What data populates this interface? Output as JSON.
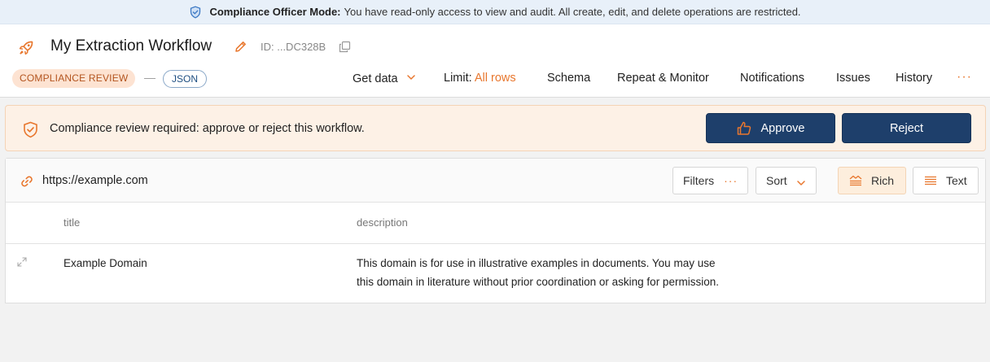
{
  "banner": {
    "mode_label": "Compliance Officer Mode:",
    "message": "You have read-only access to view and audit. All create, edit, and delete operations are restricted."
  },
  "workflow": {
    "title": "My Extraction Workflow",
    "id": "ID: ...DC328B",
    "status_badge": "COMPLIANCE REVIEW",
    "separator": "—",
    "format_badge": "JSON"
  },
  "nav": {
    "get_data": "Get data",
    "limit_label": "Limit:",
    "limit_value": "All rows",
    "schema": "Schema",
    "repeat_monitor": "Repeat & Monitor",
    "notifications": "Notifications",
    "issues": "Issues",
    "history": "History",
    "more": "···"
  },
  "review": {
    "message": "Compliance review required: approve or reject this workflow.",
    "approve_label": "Approve",
    "reject_label": "Reject"
  },
  "panel": {
    "url": "https://example.com",
    "filters_label": "Filters",
    "filters_dots": "···",
    "sort_label": "Sort",
    "rich_label": "Rich",
    "text_label": "Text",
    "columns": [
      "title",
      "description"
    ],
    "rows": [
      {
        "title": "Example Domain",
        "description_line1": "This domain is for use in illustrative examples in documents. You may use",
        "description_line2": "this domain in literature without prior coordination or asking for permission."
      }
    ]
  },
  "colors": {
    "accent": "#e8772e",
    "primary_button": "#1e3f6b",
    "banner_bg": "#e8f0f9",
    "alert_bg": "#fdf1e6"
  }
}
